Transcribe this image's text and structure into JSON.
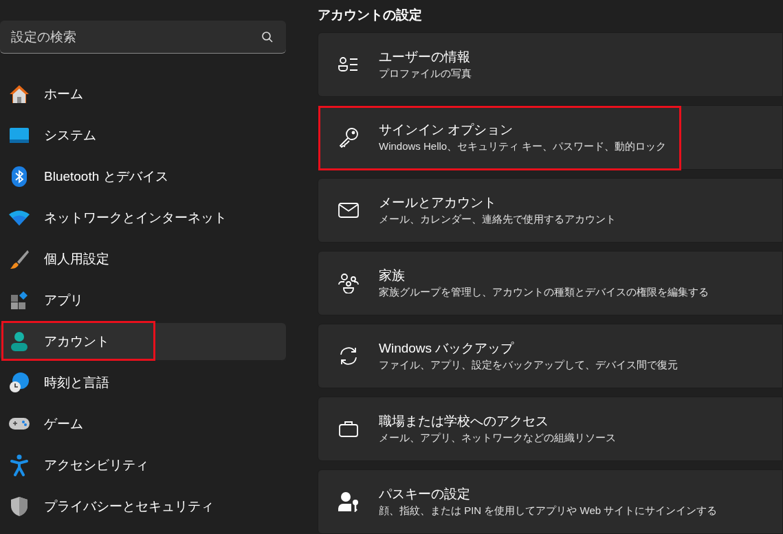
{
  "search": {
    "placeholder": "設定の検索"
  },
  "sidebar": {
    "items": [
      {
        "label": "ホーム",
        "kind": "home",
        "selected": false,
        "highlighted": false
      },
      {
        "label": "システム",
        "kind": "system",
        "selected": false,
        "highlighted": false
      },
      {
        "label": "Bluetooth とデバイス",
        "kind": "bluetooth",
        "selected": false,
        "highlighted": false
      },
      {
        "label": "ネットワークとインターネット",
        "kind": "wifi",
        "selected": false,
        "highlighted": false
      },
      {
        "label": "個人用設定",
        "kind": "brush",
        "selected": false,
        "highlighted": false
      },
      {
        "label": "アプリ",
        "kind": "apps",
        "selected": false,
        "highlighted": false
      },
      {
        "label": "アカウント",
        "kind": "account",
        "selected": true,
        "highlighted": true
      },
      {
        "label": "時刻と言語",
        "kind": "time",
        "selected": false,
        "highlighted": false
      },
      {
        "label": "ゲーム",
        "kind": "game",
        "selected": false,
        "highlighted": false
      },
      {
        "label": "アクセシビリティ",
        "kind": "accessibility",
        "selected": false,
        "highlighted": false
      },
      {
        "label": "プライバシーとセキュリティ",
        "kind": "shield",
        "selected": false,
        "highlighted": false
      }
    ]
  },
  "main": {
    "title": "アカウントの設定",
    "cards": [
      {
        "kind": "userinfo",
        "title": "ユーザーの情報",
        "subtitle": "プロファイルの写真",
        "highlighted": false
      },
      {
        "kind": "key",
        "title": "サインイン オプション",
        "subtitle": "Windows Hello、セキュリティ キー、パスワード、動的ロック",
        "highlighted": true
      },
      {
        "kind": "mail",
        "title": "メールとアカウント",
        "subtitle": "メール、カレンダー、連絡先で使用するアカウント",
        "highlighted": false
      },
      {
        "kind": "family",
        "title": "家族",
        "subtitle": "家族グループを管理し、アカウントの種類とデバイスの権限を編集する",
        "highlighted": false
      },
      {
        "kind": "sync",
        "title": "Windows バックアップ",
        "subtitle": "ファイル、アプリ、設定をバックアップして、デバイス間で復元",
        "highlighted": false
      },
      {
        "kind": "briefcase",
        "title": "職場または学校へのアクセス",
        "subtitle": "メール、アプリ、ネットワークなどの組織リソース",
        "highlighted": false
      },
      {
        "kind": "passkey",
        "title": "パスキーの設定",
        "subtitle": "顔、指紋、または PIN を使用してアプリや Web サイトにサインインする",
        "highlighted": false
      }
    ]
  }
}
